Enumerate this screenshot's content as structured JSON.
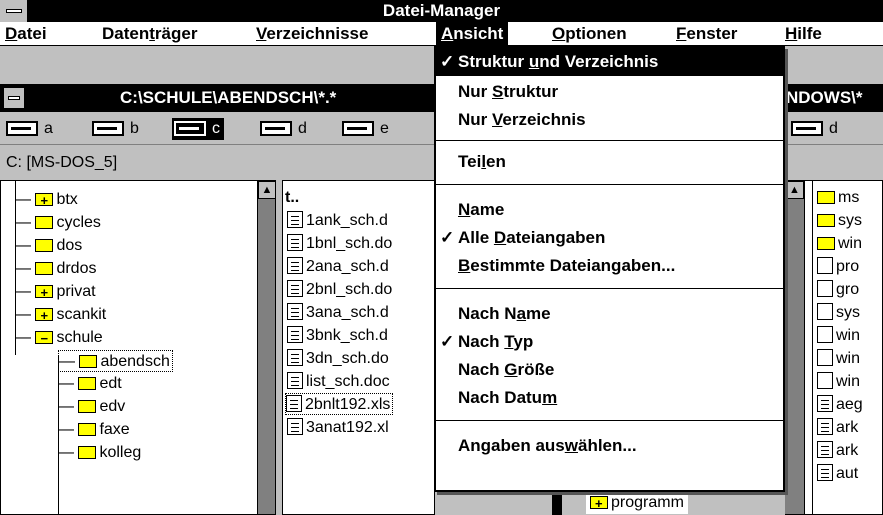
{
  "app": {
    "title": "Datei-Manager"
  },
  "menubar": {
    "items": [
      {
        "pre": "",
        "acc": "D",
        "post": "atei"
      },
      {
        "pre": "Daten",
        "acc": "t",
        "post": "räger"
      },
      {
        "pre": "",
        "acc": "V",
        "post": "erzeichnisse"
      },
      {
        "pre": "",
        "acc": "A",
        "post": "nsicht"
      },
      {
        "pre": "",
        "acc": "O",
        "post": "ptionen"
      },
      {
        "pre": "",
        "acc": "F",
        "post": "enster"
      },
      {
        "pre": "",
        "acc": "H",
        "post": "ilfe"
      }
    ]
  },
  "window_left": {
    "title": "C:\\SCHULE\\ABENDSCH\\*.*",
    "drives": [
      "a",
      "b",
      "c",
      "d",
      "e"
    ],
    "selected_drive": "c",
    "path_label": "C: [MS-DOS_5]",
    "tree": [
      {
        "name": "btx",
        "kind": "plus"
      },
      {
        "name": "cycles",
        "kind": "folder"
      },
      {
        "name": "dos",
        "kind": "folder"
      },
      {
        "name": "drdos",
        "kind": "folder"
      },
      {
        "name": "privat",
        "kind": "plus"
      },
      {
        "name": "scankit",
        "kind": "plus"
      },
      {
        "name": "schule",
        "kind": "minus"
      },
      {
        "name": "abendsch",
        "kind": "open"
      },
      {
        "name": "edt",
        "kind": "folder"
      },
      {
        "name": "edv",
        "kind": "folder"
      },
      {
        "name": "faxe",
        "kind": "folder"
      },
      {
        "name": "kolleg",
        "kind": "folder"
      }
    ],
    "files": [
      "t..",
      "1ank_sch.d",
      "1bnl_sch.do",
      "2ana_sch.d",
      "2bnl_sch.do",
      "3ana_sch.d",
      "3bnk_sch.d",
      "3dn_sch.do",
      "list_sch.doc",
      "2bnlt192.xls",
      "3anat192.xl"
    ],
    "behind_menu_label": "programm"
  },
  "window_right": {
    "title": "NDOWS\\*",
    "drives": [
      "d"
    ],
    "files": [
      "ms",
      "sys",
      "win",
      "pro",
      "gro",
      "sys",
      "win",
      "win",
      "win",
      "aeg",
      "ark",
      "ark",
      "aut"
    ]
  },
  "menu": {
    "items": [
      {
        "checked": "✓",
        "pre": "Struktur ",
        "acc": "u",
        "post": "nd Verzeichnis",
        "hi": true
      },
      {
        "checked": "",
        "pre": "Nur ",
        "acc": "S",
        "post": "truktur"
      },
      {
        "checked": "",
        "pre": "Nur ",
        "acc": "V",
        "post": "erzeichnis"
      },
      {
        "checked": "",
        "pre": "Tei",
        "acc": "l",
        "post": "en"
      },
      {
        "checked": "",
        "pre": "",
        "acc": "N",
        "post": "ame"
      },
      {
        "checked": "✓",
        "pre": "Alle ",
        "acc": "D",
        "post": "ateiangaben"
      },
      {
        "checked": "",
        "pre": "",
        "acc": "B",
        "post": "estimmte Dateiangaben..."
      },
      {
        "checked": "",
        "pre": "Nach N",
        "acc": "a",
        "post": "me"
      },
      {
        "checked": "✓",
        "pre": "Nach ",
        "acc": "T",
        "post": "yp"
      },
      {
        "checked": "",
        "pre": "Nach ",
        "acc": "G",
        "post": "röße"
      },
      {
        "checked": "",
        "pre": "Nach Datu",
        "acc": "m",
        "post": ""
      },
      {
        "checked": "",
        "pre": "Angaben aus",
        "acc": "w",
        "post": "ählen..."
      }
    ]
  }
}
